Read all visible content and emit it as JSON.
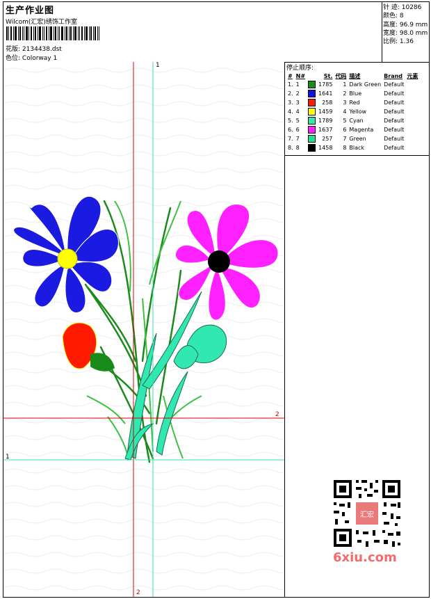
{
  "header": {
    "title": "生产作业图",
    "company": "Wilcom(汇宏)绣饰工作室",
    "design_label": "花版:",
    "design_value": "2134438.dst",
    "colorway_label": "色位:",
    "colorway_value": "Colorway 1"
  },
  "stats": {
    "stitches": "针 迹: 10286",
    "colors": "颜色: 8",
    "height": "高度: 96.9 mm",
    "width": "宽度: 98.0 mm",
    "ratio": "比例: 1.36"
  },
  "sequence": {
    "title": "停止顺序:",
    "columns": [
      "#",
      "N#",
      "St.",
      "代码",
      "描述",
      "Brand",
      "元素"
    ],
    "rows": [
      {
        "num": "1.",
        "n": "1",
        "st": "1785",
        "code": "1",
        "desc": "Dark Green",
        "brand": "Default",
        "color": "#1a8a1a"
      },
      {
        "num": "2.",
        "n": "2",
        "st": "1641",
        "code": "2",
        "desc": "Blue",
        "brand": "Default",
        "color": "#1010e0"
      },
      {
        "num": "3.",
        "n": "3",
        "st": "258",
        "code": "3",
        "desc": "Red",
        "brand": "Default",
        "color": "#ff1a00"
      },
      {
        "num": "4.",
        "n": "4",
        "st": "1459",
        "code": "4",
        "desc": "Yellow",
        "brand": "Default",
        "color": "#ffff00"
      },
      {
        "num": "5.",
        "n": "5",
        "st": "1789",
        "code": "5",
        "desc": "Cyan",
        "brand": "Default",
        "color": "#30e8b0"
      },
      {
        "num": "6.",
        "n": "6",
        "st": "1637",
        "code": "6",
        "desc": "Magenta",
        "brand": "Default",
        "color": "#ff20ff"
      },
      {
        "num": "7.",
        "n": "7",
        "st": "257",
        "code": "7",
        "desc": "Green",
        "brand": "Default",
        "color": "#20e090"
      },
      {
        "num": "8.",
        "n": "8",
        "st": "1458",
        "code": "8",
        "desc": "Black",
        "brand": "Default",
        "color": "#000000"
      }
    ]
  },
  "guides": {
    "label_1": "1",
    "label_2": "2",
    "color_red": "#e00000",
    "color_cyan": "#30e0b0"
  },
  "watermark": {
    "text": "6xiu.com",
    "qr_seal_text": "汇宏"
  }
}
